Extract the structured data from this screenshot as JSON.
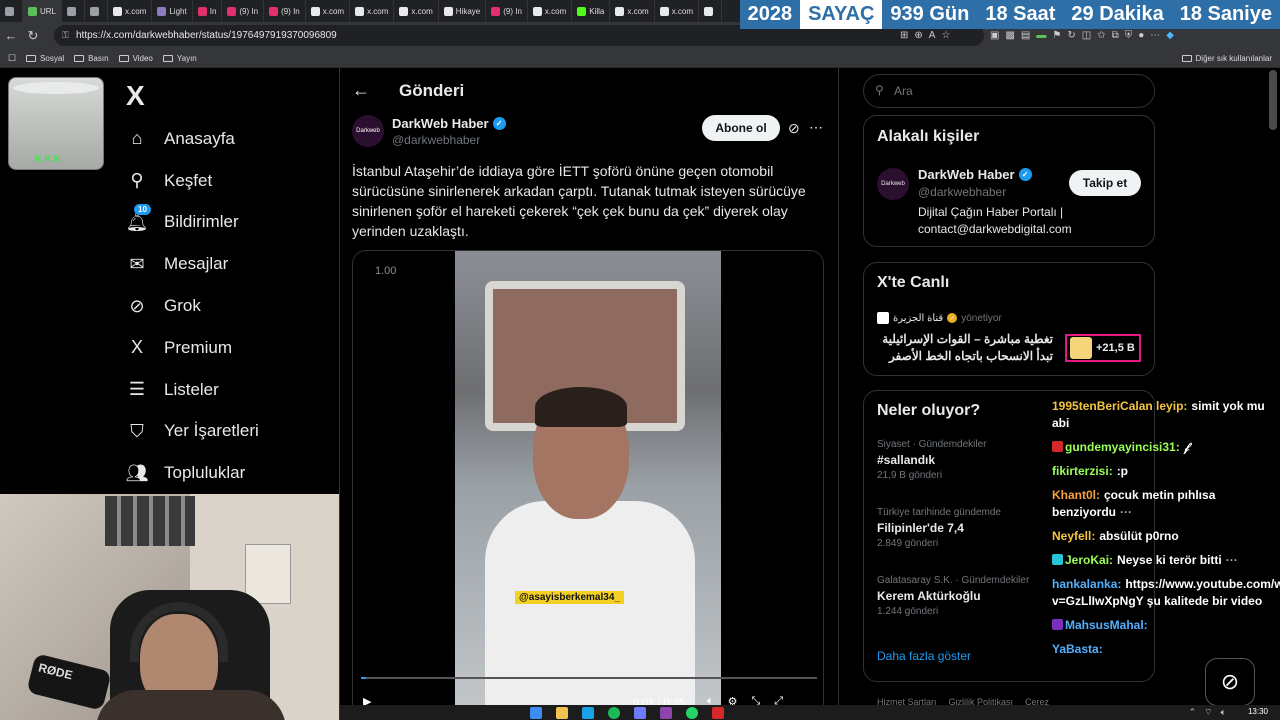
{
  "browser": {
    "tabs": [
      {
        "label": "",
        "color": "#9aa0a6"
      },
      {
        "label": "URL",
        "color": "#5ac05a"
      },
      {
        "label": "",
        "color": "#9aa0a6"
      },
      {
        "label": "",
        "color": "#9aa0a6"
      },
      {
        "label": "x.com",
        "color": "#e7e9ea"
      },
      {
        "label": "Light",
        "color": "#8e7cc3"
      },
      {
        "label": "In",
        "color": "#e1306c"
      },
      {
        "label": "(9) In",
        "color": "#e1306c"
      },
      {
        "label": "(9) In",
        "color": "#e1306c"
      },
      {
        "label": "x.com",
        "color": "#e7e9ea"
      },
      {
        "label": "x.com",
        "color": "#e7e9ea"
      },
      {
        "label": "x.com",
        "color": "#e7e9ea"
      },
      {
        "label": "Hikaye",
        "color": "#e7e9ea"
      },
      {
        "label": "(9) In",
        "color": "#e1306c"
      },
      {
        "label": "x.com",
        "color": "#e7e9ea"
      },
      {
        "label": "Killa",
        "color": "#53fc18"
      },
      {
        "label": "x.com",
        "color": "#e7e9ea"
      },
      {
        "label": "x.com",
        "color": "#e7e9ea"
      },
      {
        "label": "",
        "color": "#e7e9ea"
      }
    ],
    "url": "https://x.com/darkwebhaber/status/1976497919370096809",
    "bookmarks": [
      "Sosyal",
      "Basın",
      "Video",
      "Yayın"
    ],
    "bookmarks_right": "Diğer sık kullanılanlar"
  },
  "counter": {
    "items": [
      {
        "text": "2028",
        "bg": "#2f6fa8"
      },
      {
        "text": "SAYAÇ",
        "bg": "#ffffff",
        "fg": "#2f6fa8"
      },
      {
        "text": "939 Gün",
        "bg": "#2f6fa8"
      },
      {
        "text": "18 Saat",
        "bg": "#2f6fa8"
      },
      {
        "text": "29 Dakika",
        "bg": "#2f6fa8"
      },
      {
        "text": "18 Saniye",
        "bg": "#2f6fa8"
      }
    ]
  },
  "overlay": {
    "cup_text": "KKK",
    "mic_brand": "RØDE"
  },
  "nav": {
    "items": [
      {
        "label": "Anasayfa",
        "icon": "home-icon",
        "glyph": "⌂"
      },
      {
        "label": "Keşfet",
        "icon": "search-icon",
        "glyph": "⚲"
      },
      {
        "label": "Bildirimler",
        "icon": "bell-icon",
        "glyph": "🔔︎",
        "badge": "10"
      },
      {
        "label": "Mesajlar",
        "icon": "mail-icon",
        "glyph": "✉"
      },
      {
        "label": "Grok",
        "icon": "grok-icon",
        "glyph": "⊘"
      },
      {
        "label": "Premium",
        "icon": "x-premium-icon",
        "glyph": "X"
      },
      {
        "label": "Listeler",
        "icon": "list-icon",
        "glyph": "☰"
      },
      {
        "label": "Yer İşaretleri",
        "icon": "bookmark-icon",
        "glyph": "⛉"
      },
      {
        "label": "Topluluklar",
        "icon": "communities-icon",
        "glyph": "👥︎"
      }
    ]
  },
  "post": {
    "header_title": "Gönderi",
    "author_name": "DarkWeb Haber",
    "author_handle": "@darkwebhaber",
    "avatar_text": "Darkweb",
    "subscribe_label": "Abone ol",
    "text": "İstanbul Ataşehir’de iddiaya göre İETT şoförü önüne geçen otomobil sürücüsüne sinirlenerek arkadan çarptı. Tutanak tutmak isteyen sürücüye sinirlenen şoför el hareketi çekerek “çek çek bunu da çek” diyerek olay yerinden uzaklaştı.",
    "video": {
      "speed": "1.00",
      "watermark": "@asayisberkemal34_",
      "time": "0:01 / 0:25",
      "progress": 0.01
    }
  },
  "sidebar": {
    "search_placeholder": "Ara",
    "related": {
      "title": "Alakalı kişiler",
      "name": "DarkWeb Haber",
      "handle": "@darkwebhaber",
      "bio": "Dijital Çağın Haber Portalı | contact@darkwebdigital.com",
      "follow_label": "Takip et",
      "avatar_text": "Darkweb"
    },
    "live": {
      "title": "X'te Canlı",
      "source": "قناة الجزيرة",
      "status": "yönetiyor",
      "headline": "تغطية مباشرة – القوات الإسرائيلية تبدأ الانسحاب باتجاه الخط الأصفر",
      "viewers": "+21,5 B"
    },
    "trends": {
      "title": "Neler oluyor?",
      "items": [
        {
          "meta": "Siyaset · Gündemdekiler",
          "title": "#sallandık",
          "count": "21,9 B gönderi"
        },
        {
          "meta": "Türkiye tarihinde gündemde",
          "title": "Filipinler'de 7,4",
          "count": "2.849 gönderi"
        },
        {
          "meta": "Galatasaray S.K. · Gündemdekiler",
          "title": "Kerem Aktürkoğlu",
          "count": "1.244 gönderi"
        }
      ],
      "show_more": "Daha fazla göster"
    },
    "footer": [
      "Hizmet Şartları",
      "Gizlilik Politikası",
      "Çerez"
    ]
  },
  "chat": {
    "messages": [
      {
        "user": "1995tenBeriCalan leyip:",
        "color": "#f5c542",
        "text": "simit yok mu abi",
        "badge": ""
      },
      {
        "user": "gundemyayincisi31:",
        "color": "#9bff5a",
        "text": "𝒻",
        "badge": "#d62828"
      },
      {
        "user": "fikirterzisi:",
        "color": "#9bff5a",
        "text": ":p",
        "badge": ""
      },
      {
        "user": "Khant0l:",
        "color": "#f5a142",
        "text": "çocuk metin pıhlısa benziyordu",
        "badge": "",
        "dots": "···"
      },
      {
        "user": "Neyfell:",
        "color": "#f5c542",
        "text": "absülüt p0rno",
        "badge": ""
      },
      {
        "user": "JeroKai:",
        "color": "#9bff5a",
        "text": "Neyse ki terör bitti",
        "badge": "#26c6da",
        "dots": "···"
      },
      {
        "user": "hankalanka:",
        "color": "#52b0ff",
        "text": "https://www.youtube.com/watch?v=GzLlIwXpNgY şu kalitede bir video",
        "badge": ""
      },
      {
        "user": "MahsusMahal:",
        "color": "#52b0ff",
        "text": "",
        "badge": "#7b2fbe"
      },
      {
        "user": "YaBasta:",
        "color": "#52b0ff",
        "text": "",
        "badge": ""
      }
    ]
  },
  "taskbar": {
    "clock": "13:30"
  }
}
